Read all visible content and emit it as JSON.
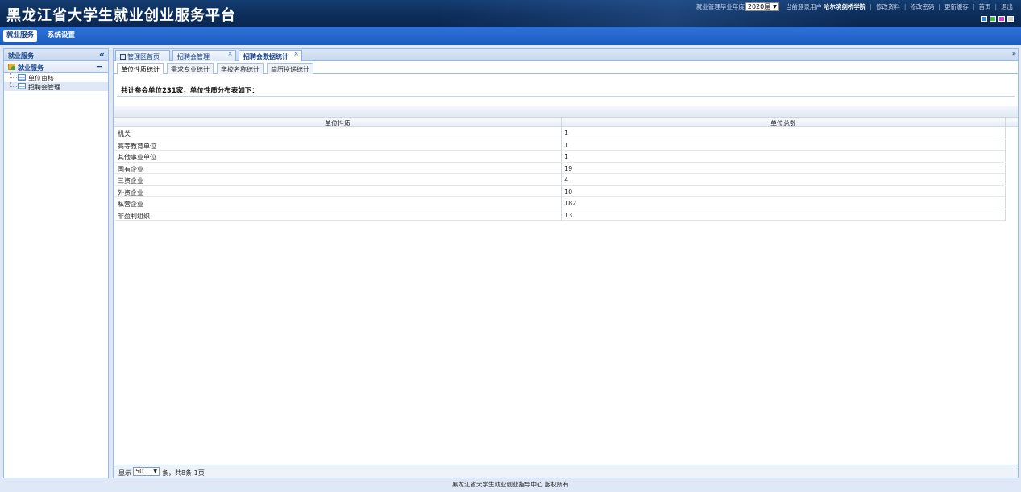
{
  "header": {
    "title": "黑龙江省大学生就业创业服务平台",
    "year_label": "就业管理毕业年度",
    "year_value": "2020届",
    "user_label": "当前登录用户",
    "user_name": "哈尔滨剑桥学院",
    "links": [
      "修改资料",
      "修改密码",
      "更新缓存",
      "首页",
      "退出"
    ],
    "theme_colors": [
      "#3c7fd6",
      "#3fc13f",
      "#d23fd2",
      "#d0d0d0"
    ]
  },
  "nav": {
    "items": [
      "就业服务",
      "系统设置"
    ]
  },
  "sidebar": {
    "title": "就业服务",
    "collapse_icon": "«",
    "group_title": "就业服务",
    "group_toggle": "−",
    "items": [
      "单位审核",
      "招聘会管理"
    ]
  },
  "tabs": {
    "items": [
      "管理区首页",
      "招聘会管理",
      "招聘会数据统计"
    ],
    "close": "×",
    "scroll": "»"
  },
  "subtabs": [
    "单位性质统计",
    "需求专业统计",
    "学校名称统计",
    "简历投递统计"
  ],
  "summary": "共计参会单位231家，单位性质分布表如下：",
  "table": {
    "columns": [
      "单位性质",
      "单位总数"
    ],
    "rows": [
      [
        "机关",
        "1"
      ],
      [
        "高等教育单位",
        "1"
      ],
      [
        "其他事业单位",
        "1"
      ],
      [
        "国有企业",
        "19"
      ],
      [
        "三资企业",
        "4"
      ],
      [
        "外资企业",
        "10"
      ],
      [
        "私营企业",
        "182"
      ],
      [
        "非盈利组织",
        "13"
      ]
    ]
  },
  "pager": {
    "show_label": "显示",
    "page_size": "50",
    "info": "条，共8条,1页"
  },
  "footer": "黑龙江省大学生就业创业指导中心 版权所有"
}
